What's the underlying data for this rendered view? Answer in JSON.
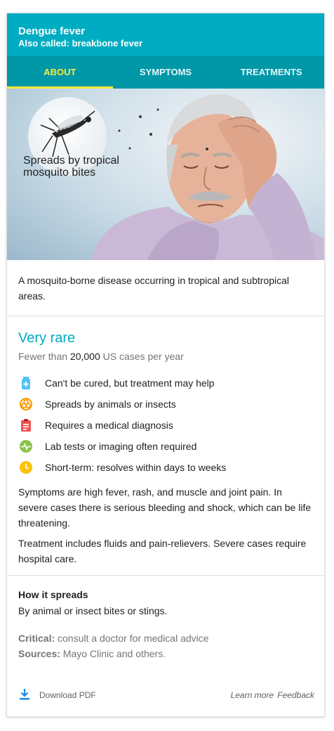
{
  "header": {
    "title": "Dengue fever",
    "subtitle": "Also called: breakbone fever"
  },
  "tabs": [
    {
      "label": "ABOUT",
      "active": true
    },
    {
      "label": "SYMPTOMS",
      "active": false
    },
    {
      "label": "TREATMENTS",
      "active": false
    }
  ],
  "hero": {
    "caption_line1": "Spreads by tropical",
    "caption_line2": "mosquito bites"
  },
  "description": "A mosquito-borne disease occurring in tropical and subtropical areas.",
  "rarity": {
    "title": "Very rare",
    "sub_prefix": "Fewer than ",
    "sub_number": "20,000",
    "sub_suffix": " US cases per year"
  },
  "facts": [
    {
      "icon": "medicine-bottle-icon",
      "color": "#4fc3f7",
      "text": "Can't be cured, but treatment may help"
    },
    {
      "icon": "biohazard-icon",
      "color": "#ff9800",
      "text": "Spreads by animals or insects"
    },
    {
      "icon": "clipboard-icon",
      "color": "#ef5350",
      "text": "Requires a medical diagnosis"
    },
    {
      "icon": "pulse-icon",
      "color": "#8bc34a",
      "text": "Lab tests or imaging often required"
    },
    {
      "icon": "clock-icon",
      "color": "#ffc107",
      "text": "Short-term: resolves within days to weeks"
    }
  ],
  "paragraphs": [
    "Symptoms are high fever, rash, and muscle and joint pain. In severe cases there is serious bleeding and shock, which can be life threatening.",
    "Treatment includes fluids and pain-relievers. Severe cases require hospital care."
  ],
  "spread": {
    "heading": "How it spreads",
    "text": "By animal or insect bites or stings."
  },
  "notes": {
    "critical_label": "Critical:",
    "critical_text": " consult a doctor for medical advice",
    "sources_label": "Sources:",
    "sources_text": " Mayo Clinic and others."
  },
  "footer": {
    "download_label": "Download PDF",
    "learn_more": "Learn more",
    "feedback": "Feedback"
  },
  "colors": {
    "header": "#00acc1",
    "tabs": "#0097a7",
    "active_tab": "#ffeb3b",
    "accent": "#00acc1"
  }
}
